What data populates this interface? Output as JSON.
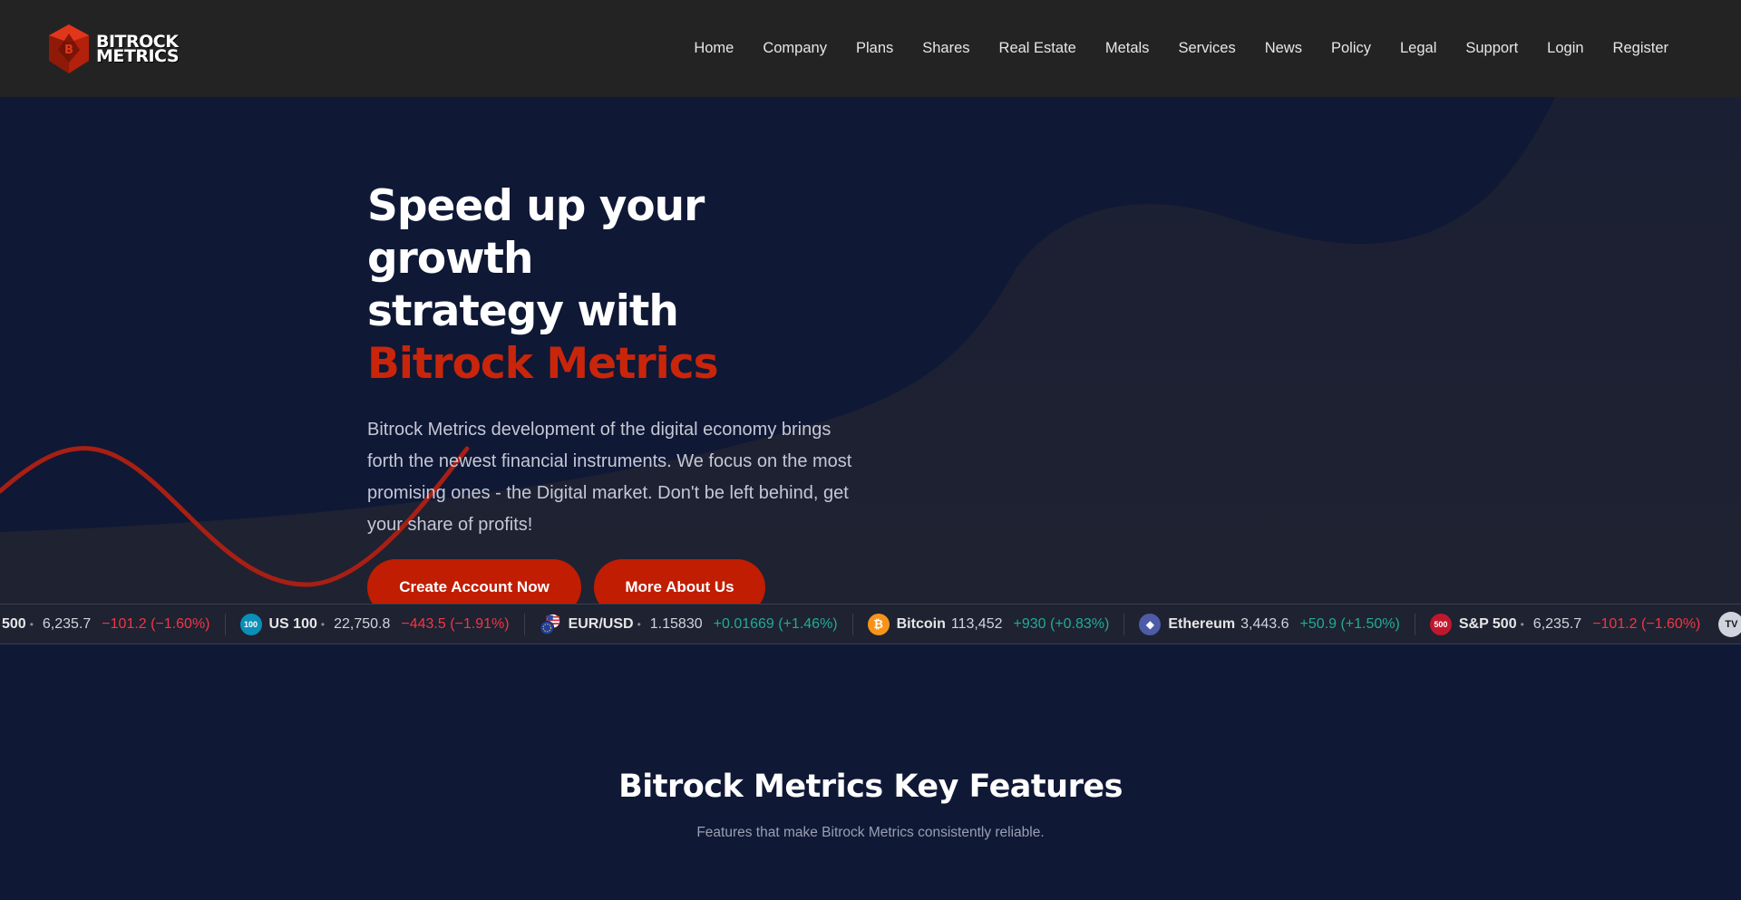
{
  "brand": {
    "logo_line1": "BITROCK",
    "logo_line2": "METRICS",
    "logo_letter": "B",
    "colors": {
      "accent": "#c11d02",
      "accent_text": "#c9250b",
      "nav_bg": "#232323",
      "page_bg": "#0f1835"
    }
  },
  "nav": {
    "items": [
      {
        "label": "Home"
      },
      {
        "label": "Company"
      },
      {
        "label": "Plans"
      },
      {
        "label": "Shares"
      },
      {
        "label": "Real Estate"
      },
      {
        "label": "Metals"
      },
      {
        "label": "Services"
      },
      {
        "label": "News"
      },
      {
        "label": "Policy"
      },
      {
        "label": "Legal"
      },
      {
        "label": "Support"
      },
      {
        "label": "Login"
      },
      {
        "label": "Register"
      }
    ]
  },
  "hero": {
    "title_line1": "Speed up your growth",
    "title_line2": "strategy with",
    "title_accent": "Bitrock Metrics",
    "description": "Bitrock Metrics development of the digital economy brings forth the newest financial instruments. We focus on the most promising ones - the Digital market. Don't be left behind, get your share of profits!",
    "primary_button": "Create Account Now",
    "secondary_button": "More About Us"
  },
  "ticker": {
    "items": [
      {
        "name": "500",
        "price": "6,235.7",
        "change": "−101.2 (−1.60%)",
        "direction": "down",
        "logo": "",
        "logo_color": "",
        "dot": true
      },
      {
        "name": "US 100",
        "price": "22,750.8",
        "change": "−443.5 (−1.91%)",
        "direction": "down",
        "logo": "100",
        "logo_color": "#0a8fb8",
        "dot": true
      },
      {
        "name": "EUR/USD",
        "price": "1.15830",
        "change": "+0.01669 (+1.46%)",
        "direction": "up",
        "logo": "flags-icon",
        "logo_color": "#1f3f9e",
        "dot": true
      },
      {
        "name": "Bitcoin",
        "price": "113,452",
        "change": "+930 (+0.83%)",
        "direction": "up",
        "logo": "₿",
        "logo_color": "#f7931a",
        "dot": false
      },
      {
        "name": "Ethereum",
        "price": "3,443.6",
        "change": "+50.9 (+1.50%)",
        "direction": "up",
        "logo": "◆",
        "logo_color": "#4e5ba6",
        "dot": false
      },
      {
        "name": "S&P 500",
        "price": "6,235.7",
        "change": "−101.2 (−1.60%)",
        "direction": "down",
        "logo": "500",
        "logo_color": "#c0172f",
        "dot": true
      }
    ],
    "badge": "TV"
  },
  "features": {
    "title": "Bitrock Metrics Key Features",
    "subtitle": "Features that make Bitrock Metrics consistently reliable."
  }
}
